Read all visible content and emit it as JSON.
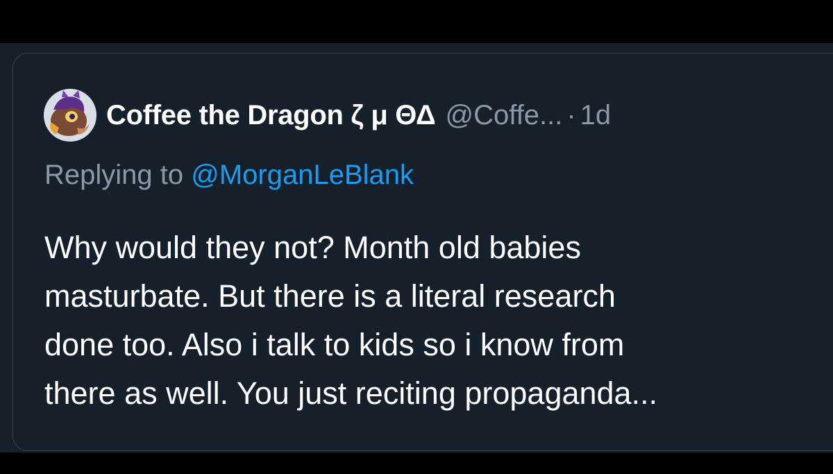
{
  "tweet": {
    "display_name": "Coffee the Dragon ζ μ ΘΔ",
    "handle": "@Coffe...",
    "separator": "·",
    "time": "1d",
    "avatar_icon": "dragon-avatar",
    "replying_prefix": "Replying to",
    "replying_to": "@MorganLeBlank",
    "body_lines": [
      "Why would they not? Month old babies",
      "masturbate. But there is a literal research",
      "done too. Also i talk to kids so i know from",
      "there as well. You just reciting propaganda..."
    ]
  },
  "colors": {
    "background": "#15202b",
    "border": "#38444d",
    "secondary_text": "#8b98a5",
    "mention": "#1d9bf0",
    "primary_text": "#ffffff"
  }
}
